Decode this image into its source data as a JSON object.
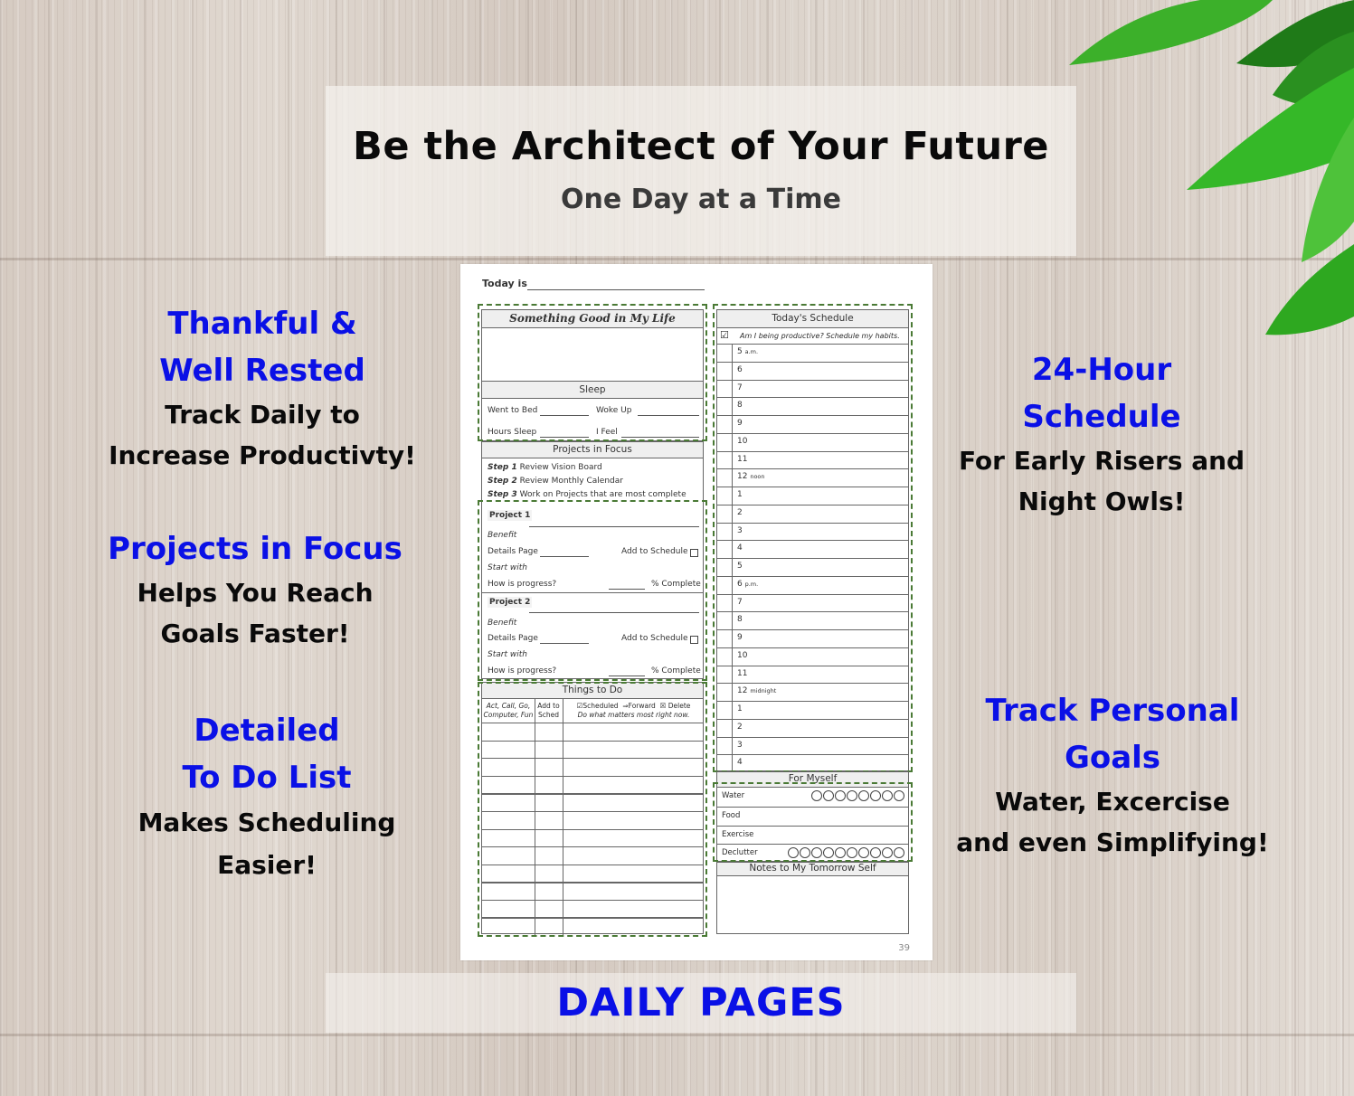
{
  "header": {
    "title": "Be the Architect of Your Future",
    "subtitle": "One Day at a Time"
  },
  "footer": {
    "title": "DAILY PAGES"
  },
  "features": {
    "left": [
      {
        "title": "Thankful &\nWell Rested",
        "desc": "Track Daily to\nIncrease Productivty!"
      },
      {
        "title": "Projects in Focus",
        "desc": "Helps You Reach\nGoals Faster!"
      },
      {
        "title": "Detailed\nTo Do List",
        "desc": "Makes Scheduling\nEasier!"
      }
    ],
    "right": [
      {
        "title": "24-Hour\nSchedule",
        "desc": "For Early Risers and\nNight Owls!"
      },
      {
        "title": "Track Personal\nGoals",
        "desc": "Water, Excercise\nand even Simplifying!"
      }
    ]
  },
  "colors": {
    "accent_blue": "#0a10e6",
    "dash_green": "#4a7a35",
    "leaf_green": "#2fa81e"
  },
  "planner": {
    "today_label": "Today is",
    "something_good": "Something Good in My Life",
    "sleep": {
      "title": "Sleep",
      "went_to_bed": "Went to Bed",
      "woke_up": "Woke Up",
      "hours_sleep": "Hours Sleep",
      "i_feel": "I Feel"
    },
    "projects": {
      "title": "Projects in Focus",
      "steps": [
        {
          "step": "Step 1",
          "text": "Review Vision Board"
        },
        {
          "step": "Step 2",
          "text": "Review Monthly Calendar"
        },
        {
          "step": "Step 3",
          "text": "Work on Projects that are most complete"
        }
      ],
      "items": [
        {
          "name": "Project 1",
          "benefit": "Benefit",
          "details": "Details Page",
          "add_to_schedule": "Add to Schedule",
          "start_with": "Start with",
          "progress": "How is progress?",
          "complete": "% Complete"
        },
        {
          "name": "Project 2",
          "benefit": "Benefit",
          "details": "Details Page",
          "add_to_schedule": "Add to Schedule",
          "start_with": "Start with",
          "progress": "How is progress?",
          "complete": "% Complete"
        }
      ]
    },
    "todo": {
      "title": "Things to Do",
      "col1": "Act, Call, Go, Computer, Fun",
      "col2": "Add to Sched",
      "legend_scheduled": "Scheduled",
      "legend_forward": "Forward",
      "legend_delete": "Delete",
      "motto": "Do what matters most right now.",
      "row_count": 11
    },
    "schedule": {
      "title": "Today's Schedule",
      "prompt": "Am I being productive? Schedule my habits.",
      "hours": [
        {
          "h": "5",
          "s": "a.m."
        },
        {
          "h": "6",
          "s": ""
        },
        {
          "h": "7",
          "s": ""
        },
        {
          "h": "8",
          "s": ""
        },
        {
          "h": "9",
          "s": ""
        },
        {
          "h": "10",
          "s": ""
        },
        {
          "h": "11",
          "s": ""
        },
        {
          "h": "12",
          "s": "noon"
        },
        {
          "h": "1",
          "s": ""
        },
        {
          "h": "2",
          "s": ""
        },
        {
          "h": "3",
          "s": ""
        },
        {
          "h": "4",
          "s": ""
        },
        {
          "h": "5",
          "s": ""
        },
        {
          "h": "6",
          "s": "p.m."
        },
        {
          "h": "7",
          "s": ""
        },
        {
          "h": "8",
          "s": ""
        },
        {
          "h": "9",
          "s": ""
        },
        {
          "h": "10",
          "s": ""
        },
        {
          "h": "11",
          "s": ""
        },
        {
          "h": "12",
          "s": "midnight"
        },
        {
          "h": "1",
          "s": ""
        },
        {
          "h": "2",
          "s": ""
        },
        {
          "h": "3",
          "s": ""
        },
        {
          "h": "4",
          "s": ""
        }
      ]
    },
    "for_myself": {
      "title": "For Myself",
      "rows": [
        {
          "label": "Water",
          "circles": 8
        },
        {
          "label": "Food",
          "circles": 0
        },
        {
          "label": "Exercise",
          "circles": 0
        },
        {
          "label": "Declutter",
          "circles": 10
        }
      ]
    },
    "notes": {
      "title": "Notes to My Tomorrow Self"
    },
    "page_number": "39"
  }
}
